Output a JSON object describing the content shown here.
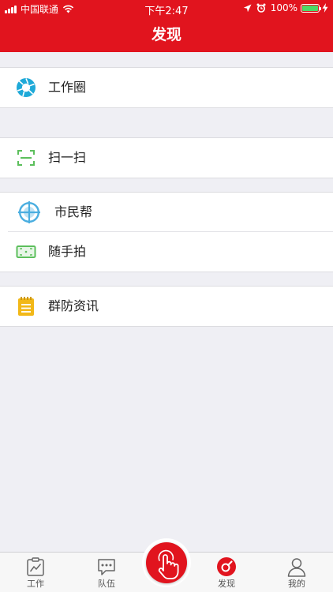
{
  "status_bar": {
    "carrier": "中国联通",
    "time": "下午2:47",
    "battery": "100%"
  },
  "header": {
    "title": "发现"
  },
  "menu": {
    "moments": {
      "label": "工作圈",
      "icon": "aperture-icon",
      "color": "#1ea9d8"
    },
    "scan": {
      "label": "扫一扫",
      "icon": "scan-icon",
      "color": "#5cbf5c"
    },
    "citizen_help": {
      "label": "市民帮",
      "icon": "crosshair-icon",
      "color": "#4aaee0"
    },
    "snapshot": {
      "label": "随手拍",
      "icon": "camera-frame-icon",
      "color": "#5cbf5c"
    },
    "news": {
      "label": "群防资讯",
      "icon": "notepad-icon",
      "color": "#f2b818"
    }
  },
  "tab_bar": {
    "work": {
      "label": "工作",
      "icon": "chart-clipboard-icon"
    },
    "team": {
      "label": "队伍",
      "icon": "chat-bubble-icon"
    },
    "center": {
      "icon": "tap-hand-icon"
    },
    "discover": {
      "label": "发现",
      "icon": "compass-icon",
      "active": true
    },
    "mine": {
      "label": "我的",
      "icon": "person-icon"
    }
  },
  "colors": {
    "brand": "#e1141e",
    "background": "#efeff4",
    "battery_green": "#4cd964"
  }
}
